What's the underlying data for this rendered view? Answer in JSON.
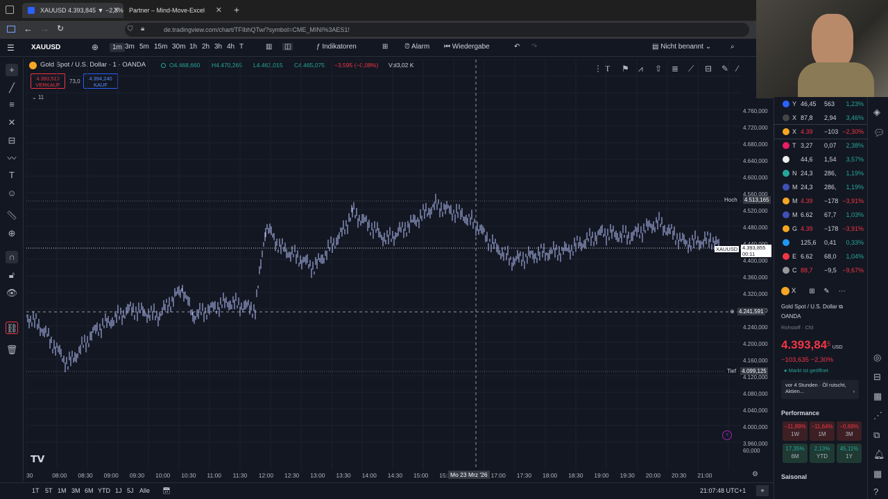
{
  "browser": {
    "tab1": "XAUUSD 4.393,845 ▼ −2,3% N",
    "tab2": "Partner – Mind-Move-Excel",
    "url": "de.tradingview.com/chart/TFIbhQTw/?symbol=CME_MINI%3AES1!"
  },
  "toolbar": {
    "symbol": "XAUUSD",
    "intervals": [
      "1m",
      "3m",
      "5m",
      "15m",
      "30m",
      "1h",
      "2h",
      "3h",
      "4h",
      "T"
    ],
    "indicators": "Indikatoren",
    "alarm": "Alarm",
    "replay": "Wiedergabe",
    "layout": "Nicht benannt"
  },
  "header": {
    "title": "Gold Spot / U.S. Dollar · 1 · OANDA",
    "o": "O4.468,660",
    "h": "H4.470,265",
    "l": "L4.463,015",
    "c": "C4.465,075",
    "chg": "−3,595 (−0,08%)",
    "vol": "Vol3,02 K",
    "sell_price": "4.393,510",
    "sell_label": "VERKAUF",
    "spread": "73,0",
    "buy_price": "4.394,240",
    "buy_label": "KAUF",
    "count": "11"
  },
  "price_axis": [
    "4.760,000",
    "4.720,000",
    "4.680,000",
    "4.640,000",
    "4.600,000",
    "4.560,000",
    "4.520,000",
    "4.480,000",
    "4.440,000",
    "4.400,000",
    "4.360,000",
    "4.320,000",
    "4.280,000",
    "4.240,000",
    "4.200,000",
    "4.160,000",
    "4.120,000",
    "4.080,000",
    "4.040,000",
    "4.000,000",
    "3.960,000",
    "60,000"
  ],
  "markers": {
    "high_label": "Hoch",
    "high_value": "4.513,165",
    "low_label": "Tief",
    "low_value": "4.099,125",
    "cur_symbol": "XAUUSD",
    "cur_value": "4.393,855",
    "cur_time": "00:11",
    "cross_value": "4.241,591"
  },
  "time_axis": [
    "30",
    "08:00",
    "08:30",
    "09:00",
    "09:30",
    "10:00",
    "10:30",
    "11:00",
    "11:30",
    "12:00",
    "12:30",
    "13:00",
    "13:30",
    "14:00",
    "14:30",
    "15:00",
    "15:30",
    "16:14",
    "17:00",
    "17:30",
    "18:00",
    "18:30",
    "19:00",
    "19:30",
    "20:00",
    "20:30",
    "21:00"
  ],
  "time_cursor": "Mo 23 Mrz '26",
  "bottom": {
    "ranges": [
      "1T",
      "5T",
      "1M",
      "3M",
      "6M",
      "YTD",
      "1J",
      "5J",
      "Alle"
    ],
    "clock": "21:07:48 UTC+1"
  },
  "watchlist": [
    {
      "sym": "Y",
      "last": "46,45",
      "chg": "563",
      "pct": "1,23%",
      "dir": "pos",
      "color": "#2962ff"
    },
    {
      "sym": "X",
      "last": "87,8",
      "chg": "2,94",
      "pct": "3,46%",
      "dir": "pos",
      "color": "#444"
    },
    {
      "sym": "X",
      "last": "4.39",
      "chg": "−103",
      "pct": "−2,30%",
      "dir": "neg",
      "color": "#f5a623"
    },
    {
      "sym": "T",
      "last": "3,27",
      "chg": "0,07",
      "pct": "2,38%",
      "dir": "pos",
      "color": "#e91e63"
    },
    {
      "sym": "",
      "last": "44,6",
      "chg": "1,54",
      "pct": "3,57%",
      "dir": "pos",
      "color": "#eee"
    },
    {
      "sym": "N",
      "last": "24,3",
      "chg": "286,",
      "pct": "1,19%",
      "dir": "pos",
      "color": "#26a69a"
    },
    {
      "sym": "M",
      "last": "24,3",
      "chg": "286,",
      "pct": "1,19%",
      "dir": "pos",
      "color": "#3f51b5"
    },
    {
      "sym": "M",
      "last": "4.39",
      "chg": "−178",
      "pct": "−3,91%",
      "dir": "neg",
      "color": "#f5a623"
    },
    {
      "sym": "M",
      "last": "6.62",
      "chg": "67,7",
      "pct": "1,03%",
      "dir": "pos",
      "color": "#3f51b5"
    },
    {
      "sym": "G",
      "last": "4.39",
      "chg": "−178",
      "pct": "−3,91%",
      "dir": "neg",
      "color": "#f5a623"
    },
    {
      "sym": "",
      "last": "125,6",
      "chg": "0,41",
      "pct": "0,33%",
      "dir": "pos",
      "color": "#2196f3"
    },
    {
      "sym": "E",
      "last": "6.62",
      "chg": "68,0",
      "pct": "1,04%",
      "dir": "pos",
      "color": "#f23645"
    },
    {
      "sym": "C",
      "last": "88,7",
      "chg": "−9,5",
      "pct": "−9,67%",
      "dir": "neg",
      "color": "#999"
    }
  ],
  "details": {
    "sym": "X",
    "name": "Gold Spot / U.S. Dollar",
    "broker": "OANDA",
    "type": "Rohstoff · Cfd",
    "price": "4.393,84",
    "price_sup": "5",
    "cur": "USD",
    "change": "−103,635 −2,30%",
    "status": "Markt ist geöffnet",
    "news": "vor 4 Stunden · Öl rutscht, Aktien...",
    "perf_title": "Performance",
    "seasonal": "Saisonal",
    "perf": [
      {
        "v": "−11,89%",
        "p": "1W",
        "c": "red"
      },
      {
        "v": "−11,64%",
        "p": "1M",
        "c": "red"
      },
      {
        "v": "−0,69%",
        "p": "3M",
        "c": "red"
      },
      {
        "v": "17,35%",
        "p": "6M",
        "c": "green"
      },
      {
        "v": "2,13%",
        "p": "YTD",
        "c": "green"
      },
      {
        "v": "45,11%",
        "p": "1Y",
        "c": "green"
      }
    ]
  },
  "colors": {
    "bg": "#131722",
    "candle": "#b8c4ff",
    "positive": "#26a69a",
    "negative": "#f23645"
  }
}
